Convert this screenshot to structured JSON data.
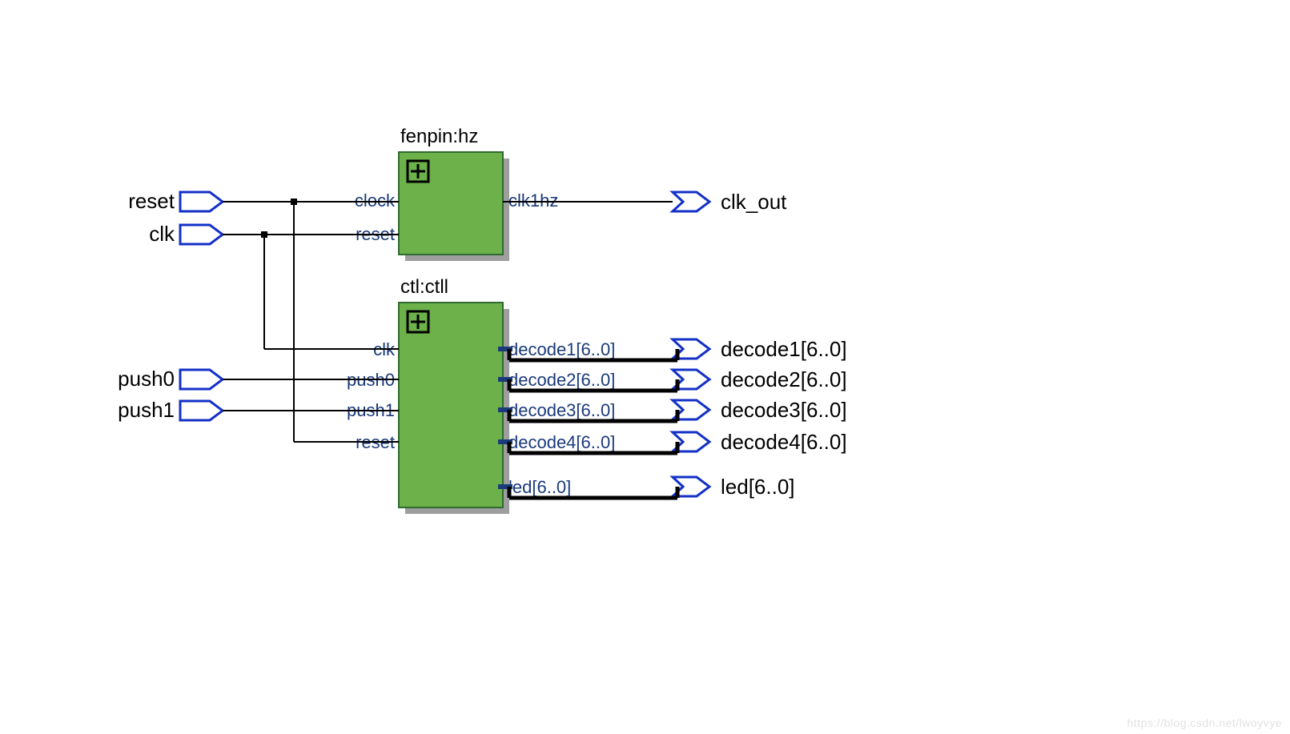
{
  "blocks": {
    "fenpin": {
      "title": "fenpin:hz",
      "ports_in": [
        "clock",
        "reset"
      ],
      "ports_out": [
        "clk1hz"
      ]
    },
    "ctl": {
      "title": "ctl:ctll",
      "ports_in": [
        "clk",
        "push0",
        "push1",
        "reset"
      ],
      "ports_out": [
        "decode1[6..0]",
        "decode2[6..0]",
        "decode3[6..0]",
        "decode4[6..0]",
        "led[6..0]"
      ]
    }
  },
  "inputs": {
    "reset": "reset",
    "clk": "clk",
    "push0": "push0",
    "push1": "push1"
  },
  "outputs": {
    "clk_out": "clk_out",
    "decode1": "decode1[6..0]",
    "decode2": "decode2[6..0]",
    "decode3": "decode3[6..0]",
    "decode4": "decode4[6..0]",
    "led": "led[6..0]"
  },
  "watermark": "https://blog.csdn.net/lwoyvye"
}
